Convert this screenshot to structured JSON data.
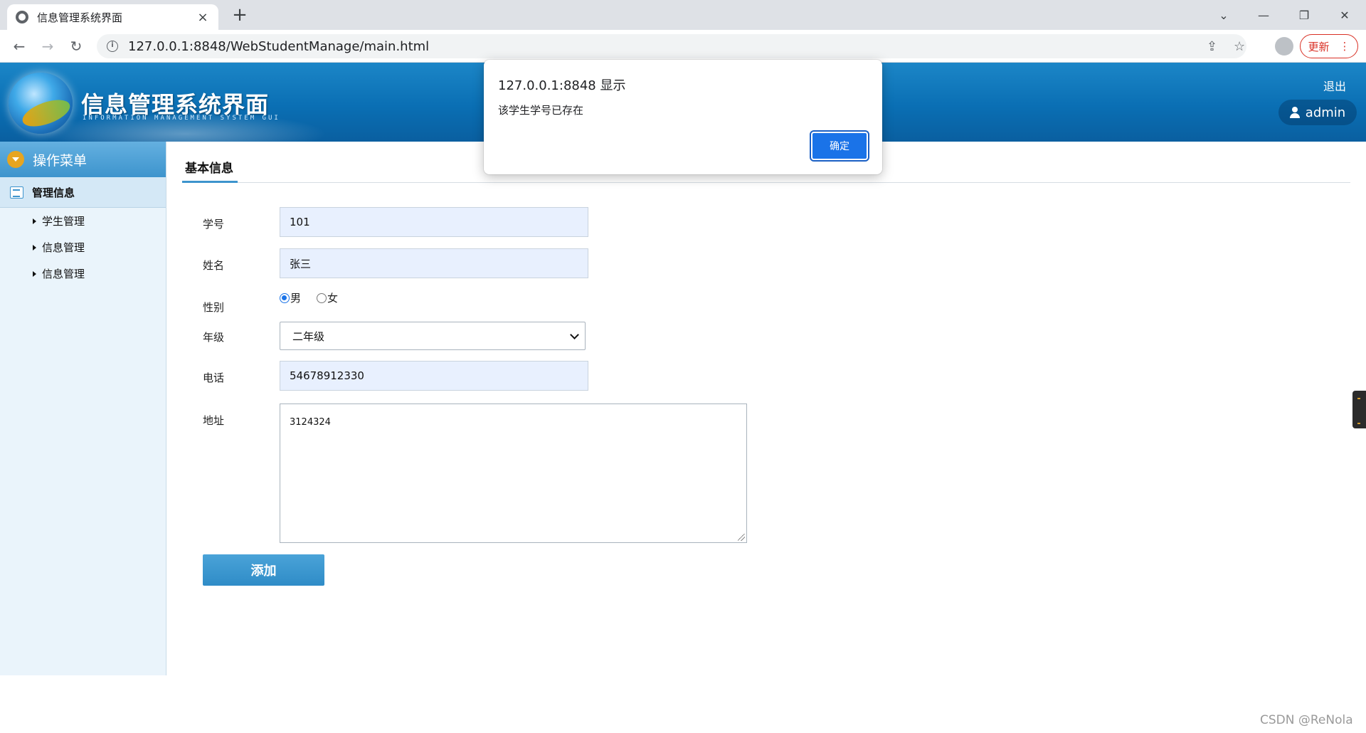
{
  "browser": {
    "tab_title": "信息管理系统界面",
    "tab_close": "×",
    "new_tab": "+",
    "url": "127.0.0.1:8848/WebStudentManage/main.html",
    "update_label": "更新",
    "window_controls": [
      "chevron-down",
      "minimize",
      "restore",
      "close"
    ]
  },
  "header": {
    "title": "信息管理系统界面",
    "subtitle": "INFORMATION MANAGEMENT SYSTEM GUI",
    "logout": "退出",
    "user": "admin"
  },
  "sidebar": {
    "menu_title": "操作菜单",
    "group": "管理信息",
    "items": [
      {
        "label": "学生管理"
      },
      {
        "label": "信息管理"
      },
      {
        "label": "信息管理"
      }
    ]
  },
  "main": {
    "tab": "基本信息",
    "form": {
      "student_id_label": "学号",
      "student_id_value": "101",
      "name_label": "姓名",
      "name_value": "张三",
      "gender_label": "性别",
      "gender_options": [
        "男",
        "女"
      ],
      "gender_selected": "男",
      "grade_label": "年级",
      "grade_value": "二年级",
      "phone_label": "电话",
      "phone_value": "54678912330",
      "address_label": "地址",
      "address_value": "3124324",
      "submit_label": "添加"
    }
  },
  "dialog": {
    "title": "127.0.0.1:8848 显示",
    "message": "该学生学号已存在",
    "ok_label": "确定"
  },
  "watermark": "CSDN @ReNola",
  "colors": {
    "header_blue": "#0a6fb4",
    "sidebar_bg": "#eaf4fb",
    "accent": "#3d94cd",
    "dialog_button": "#1a73e8",
    "update_red": "#d93025"
  }
}
